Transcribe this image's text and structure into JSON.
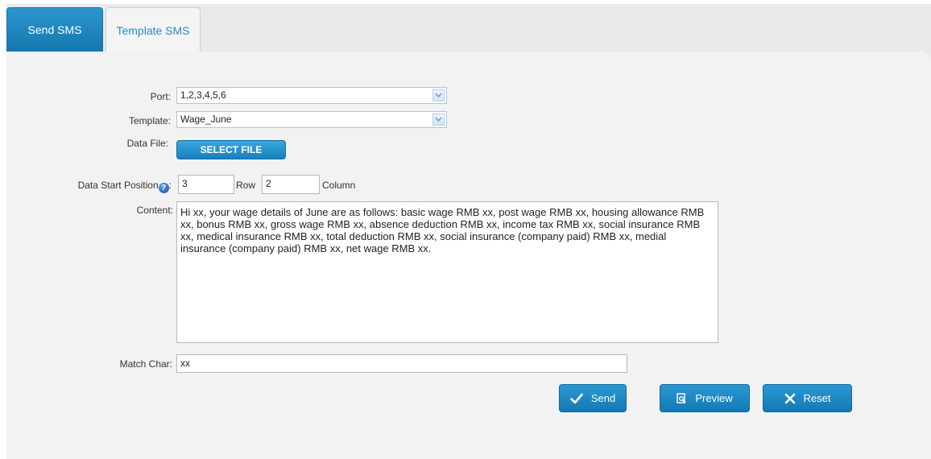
{
  "tabs": {
    "send": "Send SMS",
    "template": "Template SMS"
  },
  "form": {
    "port_label": "Port:",
    "port_value": "1,2,3,4,5,6",
    "template_label": "Template:",
    "template_value": "Wage_June",
    "data_file_label": "Data File:",
    "select_file_label": "SELECT FILE",
    "data_start_label": "Data Start Position",
    "data_start_colon": ":",
    "row_value": "3",
    "row_label": "Row",
    "column_value": "2",
    "column_label": "Column",
    "content_label": "Content:",
    "content_value": "Hi xx, your wage details of June are as follows: basic wage RMB xx, post wage RMB xx, housing allowance RMB xx, bonus RMB xx, gross wage RMB xx, absence deduction RMB xx, income tax RMB xx, social insurance RMB xx, medical insurance RMB xx, total deduction RMB xx, social insurance (company paid) RMB xx, medial insurance (company paid) RMB xx, net wage RMB xx.",
    "match_char_label": "Match Char:",
    "match_char_value": "xx"
  },
  "buttons": {
    "send": "Send",
    "preview": "Preview",
    "reset": "Reset"
  },
  "icons": {
    "help": "help-icon",
    "dropdown": "chevron-down-icon",
    "send": "check-icon",
    "preview": "preview-icon",
    "reset": "close-icon"
  },
  "colors": {
    "accent": "#1a86c2",
    "panel": "#f2f2f2"
  }
}
